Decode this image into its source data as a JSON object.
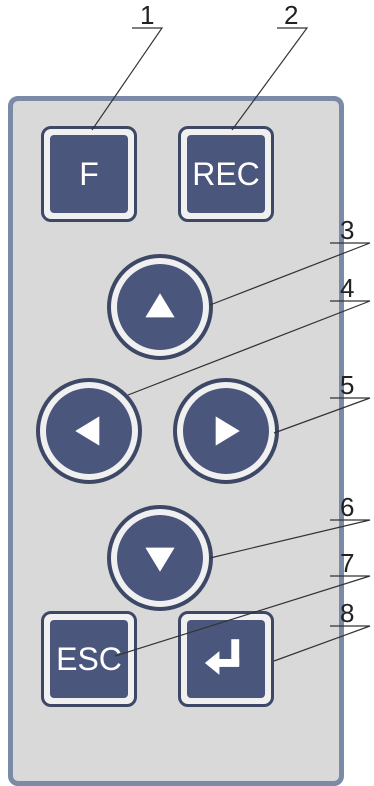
{
  "buttons": {
    "f": {
      "label": "F",
      "icon": "text-label"
    },
    "rec": {
      "label": "REC",
      "icon": "text-label"
    },
    "up": {
      "icon": "triangle-up-icon"
    },
    "left": {
      "icon": "triangle-left-icon"
    },
    "right": {
      "icon": "triangle-right-icon"
    },
    "down": {
      "icon": "triangle-down-icon"
    },
    "esc": {
      "label": "ESC",
      "icon": "text-label"
    },
    "enter": {
      "icon": "enter-arrow-icon"
    }
  },
  "callouts": [
    "1",
    "2",
    "3",
    "4",
    "5",
    "6",
    "7",
    "8"
  ],
  "colors": {
    "panel_fill": "#d9d9d9",
    "panel_border": "#7b8aa6",
    "button_face": "#4b567d",
    "button_ring": "#3d4766",
    "glyph": "#ffffff"
  }
}
